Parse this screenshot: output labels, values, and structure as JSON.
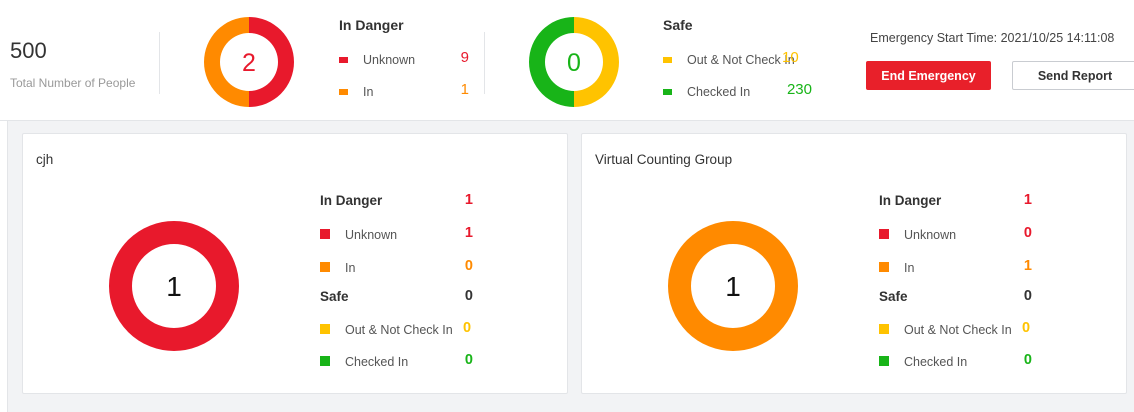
{
  "colors": {
    "danger": "#e8192c",
    "in": "#ff8a00",
    "out": "#ffc300",
    "checked": "#18b418",
    "dark": "#333333"
  },
  "summary": {
    "total_value": "500",
    "total_label": "Total Number of People",
    "in_danger": {
      "count": "2",
      "title": "In Danger",
      "items": [
        {
          "label": "Unknown",
          "value": "9"
        },
        {
          "label": "In",
          "value": "1"
        }
      ]
    },
    "safe": {
      "count": "0",
      "title": "Safe",
      "items": [
        {
          "label": "Out & Not Check In",
          "value": "10"
        },
        {
          "label": "Checked In",
          "value": "230"
        }
      ]
    },
    "emergency_start": "Emergency Start Time: 2021/10/25 14:11:08",
    "end_button": "End Emergency",
    "report_button": "Send Report"
  },
  "groups": [
    {
      "title": "cjh",
      "count": "1",
      "in_danger_title": "In Danger",
      "in_danger_value": "1",
      "danger_items": [
        {
          "label": "Unknown",
          "value": "1"
        },
        {
          "label": "In",
          "value": "0"
        }
      ],
      "safe_title": "Safe",
      "safe_value": "0",
      "safe_items": [
        {
          "label": "Out & Not Check In",
          "value": "0"
        },
        {
          "label": "Checked In",
          "value": "0"
        }
      ]
    },
    {
      "title": "Virtual Counting Group",
      "count": "1",
      "in_danger_title": "In Danger",
      "in_danger_value": "1",
      "danger_items": [
        {
          "label": "Unknown",
          "value": "0"
        },
        {
          "label": "In",
          "value": "1"
        }
      ],
      "safe_title": "Safe",
      "safe_value": "0",
      "safe_items": [
        {
          "label": "Out & Not Check In",
          "value": "0"
        },
        {
          "label": "Checked In",
          "value": "0"
        }
      ]
    }
  ]
}
